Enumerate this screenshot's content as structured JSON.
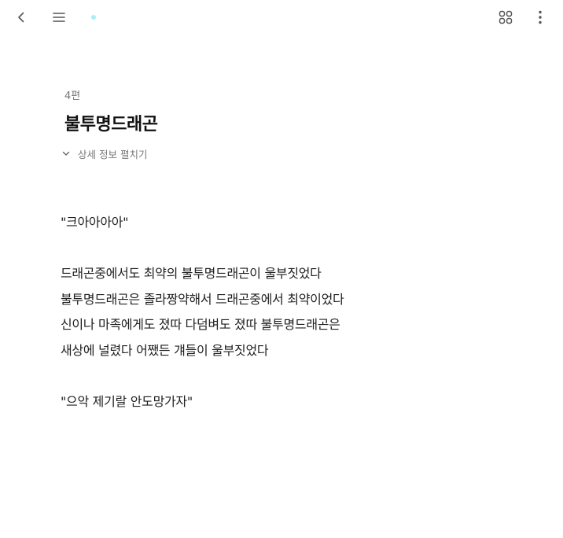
{
  "header": {
    "episode_no": "4편",
    "title": "불투명드래곤",
    "details_toggle": "상세 정보 펼치기"
  },
  "topbar": {
    "icons": [
      "chevron-left-icon",
      "hamburger-menu-icon",
      "grid-icon",
      "more-vertical-icon"
    ],
    "loading_color": "#a7f0f7"
  },
  "body": {
    "lines": [
      "\"크아아아아\"",
      "",
      "드래곤중에서도 최약의 불투명드래곤이 울부짓었다",
      "불투명드래곤은 졸라짱약해서 드래곤중에서 최약이었다",
      "신이나 마족에게도 졌따 다덤벼도 졌따 불투명드래곤은",
      "새상에 널렸다 어쨌든 걔들이 울부짓었다",
      "",
      "\"으악 제기랄 안도망가자\""
    ]
  }
}
